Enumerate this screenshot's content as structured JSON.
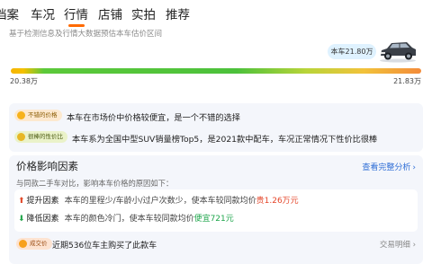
{
  "nav": {
    "tabs": [
      "档案",
      "车况",
      "行情",
      "店铺",
      "实拍",
      "推荐"
    ],
    "active_index": 2,
    "accent_color": "#ff6a00"
  },
  "subtitle": "基于检测信息及行情大数据预估本车估价区间",
  "price": {
    "current_label": "本车21.80万",
    "min": "20.38万",
    "max": "21.83万",
    "car_icon": "suv-car-icon"
  },
  "highlights": [
    {
      "tag": "不错的价格",
      "text": "本车在市场价中价格较便宜，是一个不错的选择"
    },
    {
      "tag": "很棒的性价比",
      "text": "本车系为全国中型SUV销量榜Top5，是2021款中配车，车况正常情况下性价比很棒"
    }
  ],
  "factors_section": {
    "title": "价格影响因素",
    "link": "查看完整分析",
    "subtitle": "与同款二手车对比，影响本车价格的原因如下：",
    "factors": [
      {
        "label": "提升因素",
        "desc": "本车的里程少/车龄小/过户次数少，使本车较同款均价",
        "value": "贵1.26万元",
        "direction": "up"
      },
      {
        "label": "降低因素",
        "desc": "本车的颜色冷门，使本车较同款均价",
        "value": "便宜721元",
        "direction": "down"
      }
    ],
    "deal": {
      "tag": "成交价",
      "text": "近期536位车主购买了此款车",
      "link": "交易明细"
    }
  }
}
